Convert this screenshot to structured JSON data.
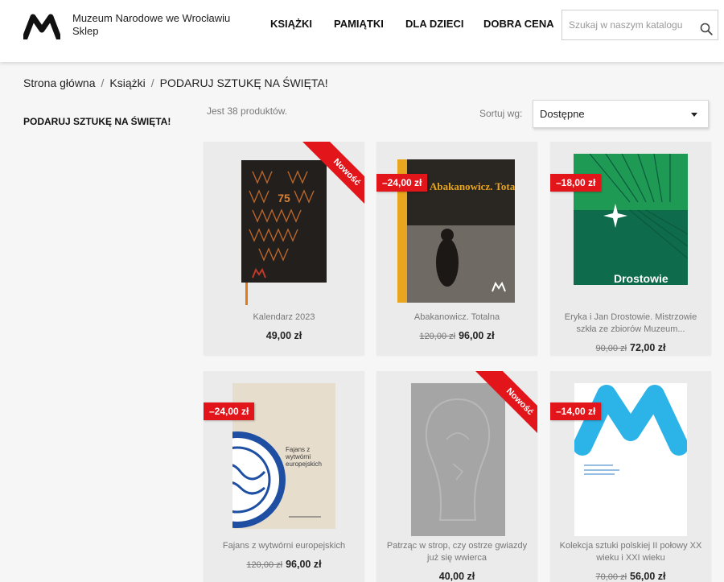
{
  "header": {
    "brand_line1": "Muzeum Narodowe we Wrocławiu",
    "brand_line2": "Sklep",
    "nav": [
      "KSIĄŻKI",
      "PAMIĄTKI",
      "DLA DZIECI",
      "DOBRA CENA"
    ],
    "search_placeholder": "Szukaj w naszym katalogu"
  },
  "breadcrumb": [
    "Strona główna",
    "Książki",
    "PODARUJ SZTUKĘ NA ŚWIĘTA!"
  ],
  "sidebar": {
    "title": "PODARUJ SZTUKĘ NA ŚWIĘTA!"
  },
  "listing": {
    "count": "Jest 38 produktów.",
    "sort_label": "Sortuj wg:",
    "sort_value": "Dostępne"
  },
  "products": [
    {
      "name": "Kalendarz 2023",
      "old_price": "",
      "price": "49,00 zł",
      "badge": "",
      "ribbon": "Nowość",
      "cover_text": "75"
    },
    {
      "name": "Abakanowicz. Totalna",
      "old_price": "120,00 zł",
      "price": "96,00 zł",
      "badge": "–24,00 zł",
      "ribbon": "",
      "cover_text": "Abakanowicz. Totalna"
    },
    {
      "name": "Eryka i Jan Drostowie. Mistrzowie szkła ze zbiorów Muzeum...",
      "old_price": "90,00 zł",
      "price": "72,00 zł",
      "badge": "–18,00 zł",
      "ribbon": "",
      "cover_text": "Drostowie"
    },
    {
      "name": "Fajans z wytwórni europejskich",
      "old_price": "120,00 zł",
      "price": "96,00 zł",
      "badge": "–24,00 zł",
      "ribbon": "",
      "cover_text": "Fajans z wytwórni europejskich"
    },
    {
      "name": "Patrząc w strop, czy ostrze gwiazdy już się wwierca",
      "old_price": "",
      "price": "40,00 zł",
      "badge": "",
      "ribbon": "Nowość",
      "cover_text": ""
    },
    {
      "name": "Kolekcja sztuki polskiej II połowy XX wieku i XXI wieku",
      "old_price": "70,00 zł",
      "price": "56,00 zł",
      "badge": "–14,00 zł",
      "ribbon": "",
      "cover_text": ""
    }
  ],
  "colors": {
    "accent": "#e2151b",
    "background": "#f6f6f6",
    "card": "#ebebeb",
    "logo": "#111111",
    "museum_blue": "#2cb3e8",
    "drost_green": "#0e6b4b"
  }
}
